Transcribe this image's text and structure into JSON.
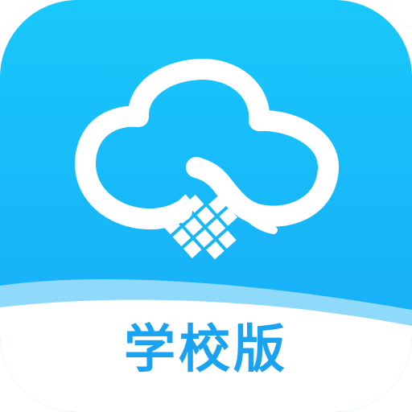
{
  "app_icon": {
    "label": "学校版",
    "logo_icon": "cloud-with-grid-icon",
    "colors": {
      "gradient_top": "#19c8fb",
      "gradient_bottom": "#17a9f6",
      "wave_light": "#8fd9fb",
      "cloud_outline": "#ffffff",
      "label_band": "#ffffff",
      "label_text": "#1aa3f0"
    }
  }
}
